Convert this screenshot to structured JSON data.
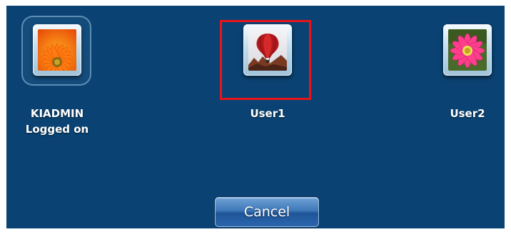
{
  "users": [
    {
      "name": "KIADMIN",
      "status": "Logged on",
      "picture_icon": "orange-gerbera-flower-icon"
    },
    {
      "name": "User1",
      "status": "",
      "picture_icon": "hot-air-balloon-icon",
      "highlighted": true
    },
    {
      "name": "User2",
      "status": "",
      "picture_icon": "pink-flower-icon"
    }
  ],
  "cancel_label": "Cancel",
  "colors": {
    "background": "#0a4373",
    "highlight_border": "#e8141a",
    "text": "#ffffff"
  }
}
